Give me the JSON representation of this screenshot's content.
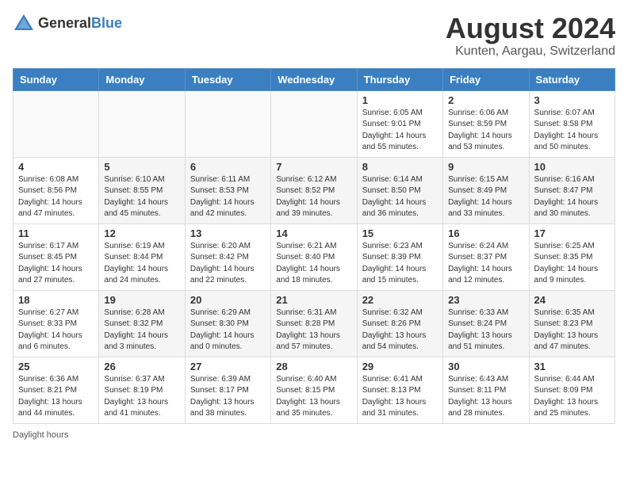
{
  "header": {
    "logo_general": "General",
    "logo_blue": "Blue",
    "month_title": "August 2024",
    "location": "Kunten, Aargau, Switzerland"
  },
  "days_of_week": [
    "Sunday",
    "Monday",
    "Tuesday",
    "Wednesday",
    "Thursday",
    "Friday",
    "Saturday"
  ],
  "weeks": [
    [
      {
        "day": "",
        "info": ""
      },
      {
        "day": "",
        "info": ""
      },
      {
        "day": "",
        "info": ""
      },
      {
        "day": "",
        "info": ""
      },
      {
        "day": "1",
        "info": "Sunrise: 6:05 AM\nSunset: 9:01 PM\nDaylight: 14 hours\nand 55 minutes."
      },
      {
        "day": "2",
        "info": "Sunrise: 6:06 AM\nSunset: 8:59 PM\nDaylight: 14 hours\nand 53 minutes."
      },
      {
        "day": "3",
        "info": "Sunrise: 6:07 AM\nSunset: 8:58 PM\nDaylight: 14 hours\nand 50 minutes."
      }
    ],
    [
      {
        "day": "4",
        "info": "Sunrise: 6:08 AM\nSunset: 8:56 PM\nDaylight: 14 hours\nand 47 minutes."
      },
      {
        "day": "5",
        "info": "Sunrise: 6:10 AM\nSunset: 8:55 PM\nDaylight: 14 hours\nand 45 minutes."
      },
      {
        "day": "6",
        "info": "Sunrise: 6:11 AM\nSunset: 8:53 PM\nDaylight: 14 hours\nand 42 minutes."
      },
      {
        "day": "7",
        "info": "Sunrise: 6:12 AM\nSunset: 8:52 PM\nDaylight: 14 hours\nand 39 minutes."
      },
      {
        "day": "8",
        "info": "Sunrise: 6:14 AM\nSunset: 8:50 PM\nDaylight: 14 hours\nand 36 minutes."
      },
      {
        "day": "9",
        "info": "Sunrise: 6:15 AM\nSunset: 8:49 PM\nDaylight: 14 hours\nand 33 minutes."
      },
      {
        "day": "10",
        "info": "Sunrise: 6:16 AM\nSunset: 8:47 PM\nDaylight: 14 hours\nand 30 minutes."
      }
    ],
    [
      {
        "day": "11",
        "info": "Sunrise: 6:17 AM\nSunset: 8:45 PM\nDaylight: 14 hours\nand 27 minutes."
      },
      {
        "day": "12",
        "info": "Sunrise: 6:19 AM\nSunset: 8:44 PM\nDaylight: 14 hours\nand 24 minutes."
      },
      {
        "day": "13",
        "info": "Sunrise: 6:20 AM\nSunset: 8:42 PM\nDaylight: 14 hours\nand 22 minutes."
      },
      {
        "day": "14",
        "info": "Sunrise: 6:21 AM\nSunset: 8:40 PM\nDaylight: 14 hours\nand 18 minutes."
      },
      {
        "day": "15",
        "info": "Sunrise: 6:23 AM\nSunset: 8:39 PM\nDaylight: 14 hours\nand 15 minutes."
      },
      {
        "day": "16",
        "info": "Sunrise: 6:24 AM\nSunset: 8:37 PM\nDaylight: 14 hours\nand 12 minutes."
      },
      {
        "day": "17",
        "info": "Sunrise: 6:25 AM\nSunset: 8:35 PM\nDaylight: 14 hours\nand 9 minutes."
      }
    ],
    [
      {
        "day": "18",
        "info": "Sunrise: 6:27 AM\nSunset: 8:33 PM\nDaylight: 14 hours\nand 6 minutes."
      },
      {
        "day": "19",
        "info": "Sunrise: 6:28 AM\nSunset: 8:32 PM\nDaylight: 14 hours\nand 3 minutes."
      },
      {
        "day": "20",
        "info": "Sunrise: 6:29 AM\nSunset: 8:30 PM\nDaylight: 14 hours\nand 0 minutes."
      },
      {
        "day": "21",
        "info": "Sunrise: 6:31 AM\nSunset: 8:28 PM\nDaylight: 13 hours\nand 57 minutes."
      },
      {
        "day": "22",
        "info": "Sunrise: 6:32 AM\nSunset: 8:26 PM\nDaylight: 13 hours\nand 54 minutes."
      },
      {
        "day": "23",
        "info": "Sunrise: 6:33 AM\nSunset: 8:24 PM\nDaylight: 13 hours\nand 51 minutes."
      },
      {
        "day": "24",
        "info": "Sunrise: 6:35 AM\nSunset: 8:23 PM\nDaylight: 13 hours\nand 47 minutes."
      }
    ],
    [
      {
        "day": "25",
        "info": "Sunrise: 6:36 AM\nSunset: 8:21 PM\nDaylight: 13 hours\nand 44 minutes."
      },
      {
        "day": "26",
        "info": "Sunrise: 6:37 AM\nSunset: 8:19 PM\nDaylight: 13 hours\nand 41 minutes."
      },
      {
        "day": "27",
        "info": "Sunrise: 6:39 AM\nSunset: 8:17 PM\nDaylight: 13 hours\nand 38 minutes."
      },
      {
        "day": "28",
        "info": "Sunrise: 6:40 AM\nSunset: 8:15 PM\nDaylight: 13 hours\nand 35 minutes."
      },
      {
        "day": "29",
        "info": "Sunrise: 6:41 AM\nSunset: 8:13 PM\nDaylight: 13 hours\nand 31 minutes."
      },
      {
        "day": "30",
        "info": "Sunrise: 6:43 AM\nSunset: 8:11 PM\nDaylight: 13 hours\nand 28 minutes."
      },
      {
        "day": "31",
        "info": "Sunrise: 6:44 AM\nSunset: 8:09 PM\nDaylight: 13 hours\nand 25 minutes."
      }
    ]
  ],
  "footer": {
    "note": "Daylight hours"
  }
}
